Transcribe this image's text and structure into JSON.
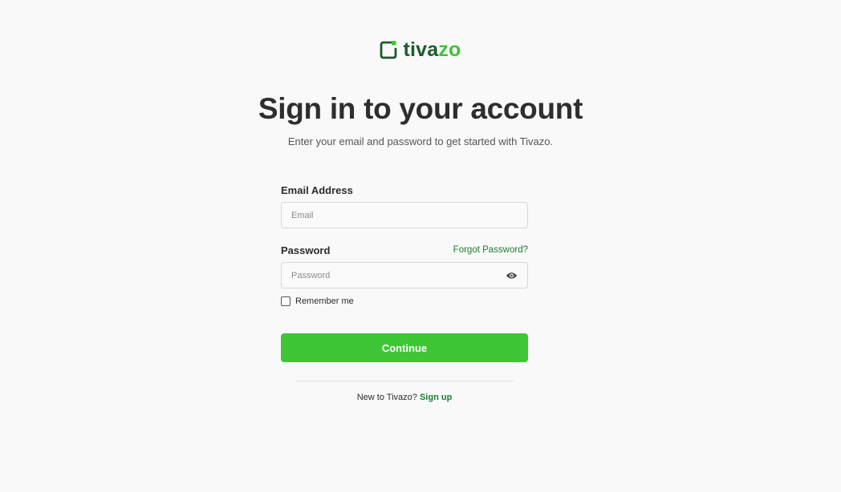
{
  "brand": {
    "name_part_a": "tiva",
    "name_part_b": "zo",
    "icon": "logo-square-icon",
    "color_dark": "#1c5a2a",
    "color_accent": "#3ec336"
  },
  "header": {
    "title": "Sign in to your account",
    "subtitle": "Enter your email and password to get started with Tivazo."
  },
  "form": {
    "email": {
      "label": "Email Address",
      "placeholder": "Email",
      "value": ""
    },
    "password": {
      "label": "Password",
      "placeholder": "Password",
      "value": "",
      "toggle_icon": "eye-icon"
    },
    "forgot_label": "Forgot Password?",
    "remember_label": "Remember me",
    "remember_checked": false,
    "submit_label": "Continue",
    "submit_color": "#3ec636"
  },
  "footer": {
    "prompt": "New to Tivazo?",
    "signup_label": "Sign up",
    "link_color": "#1e7a33"
  }
}
